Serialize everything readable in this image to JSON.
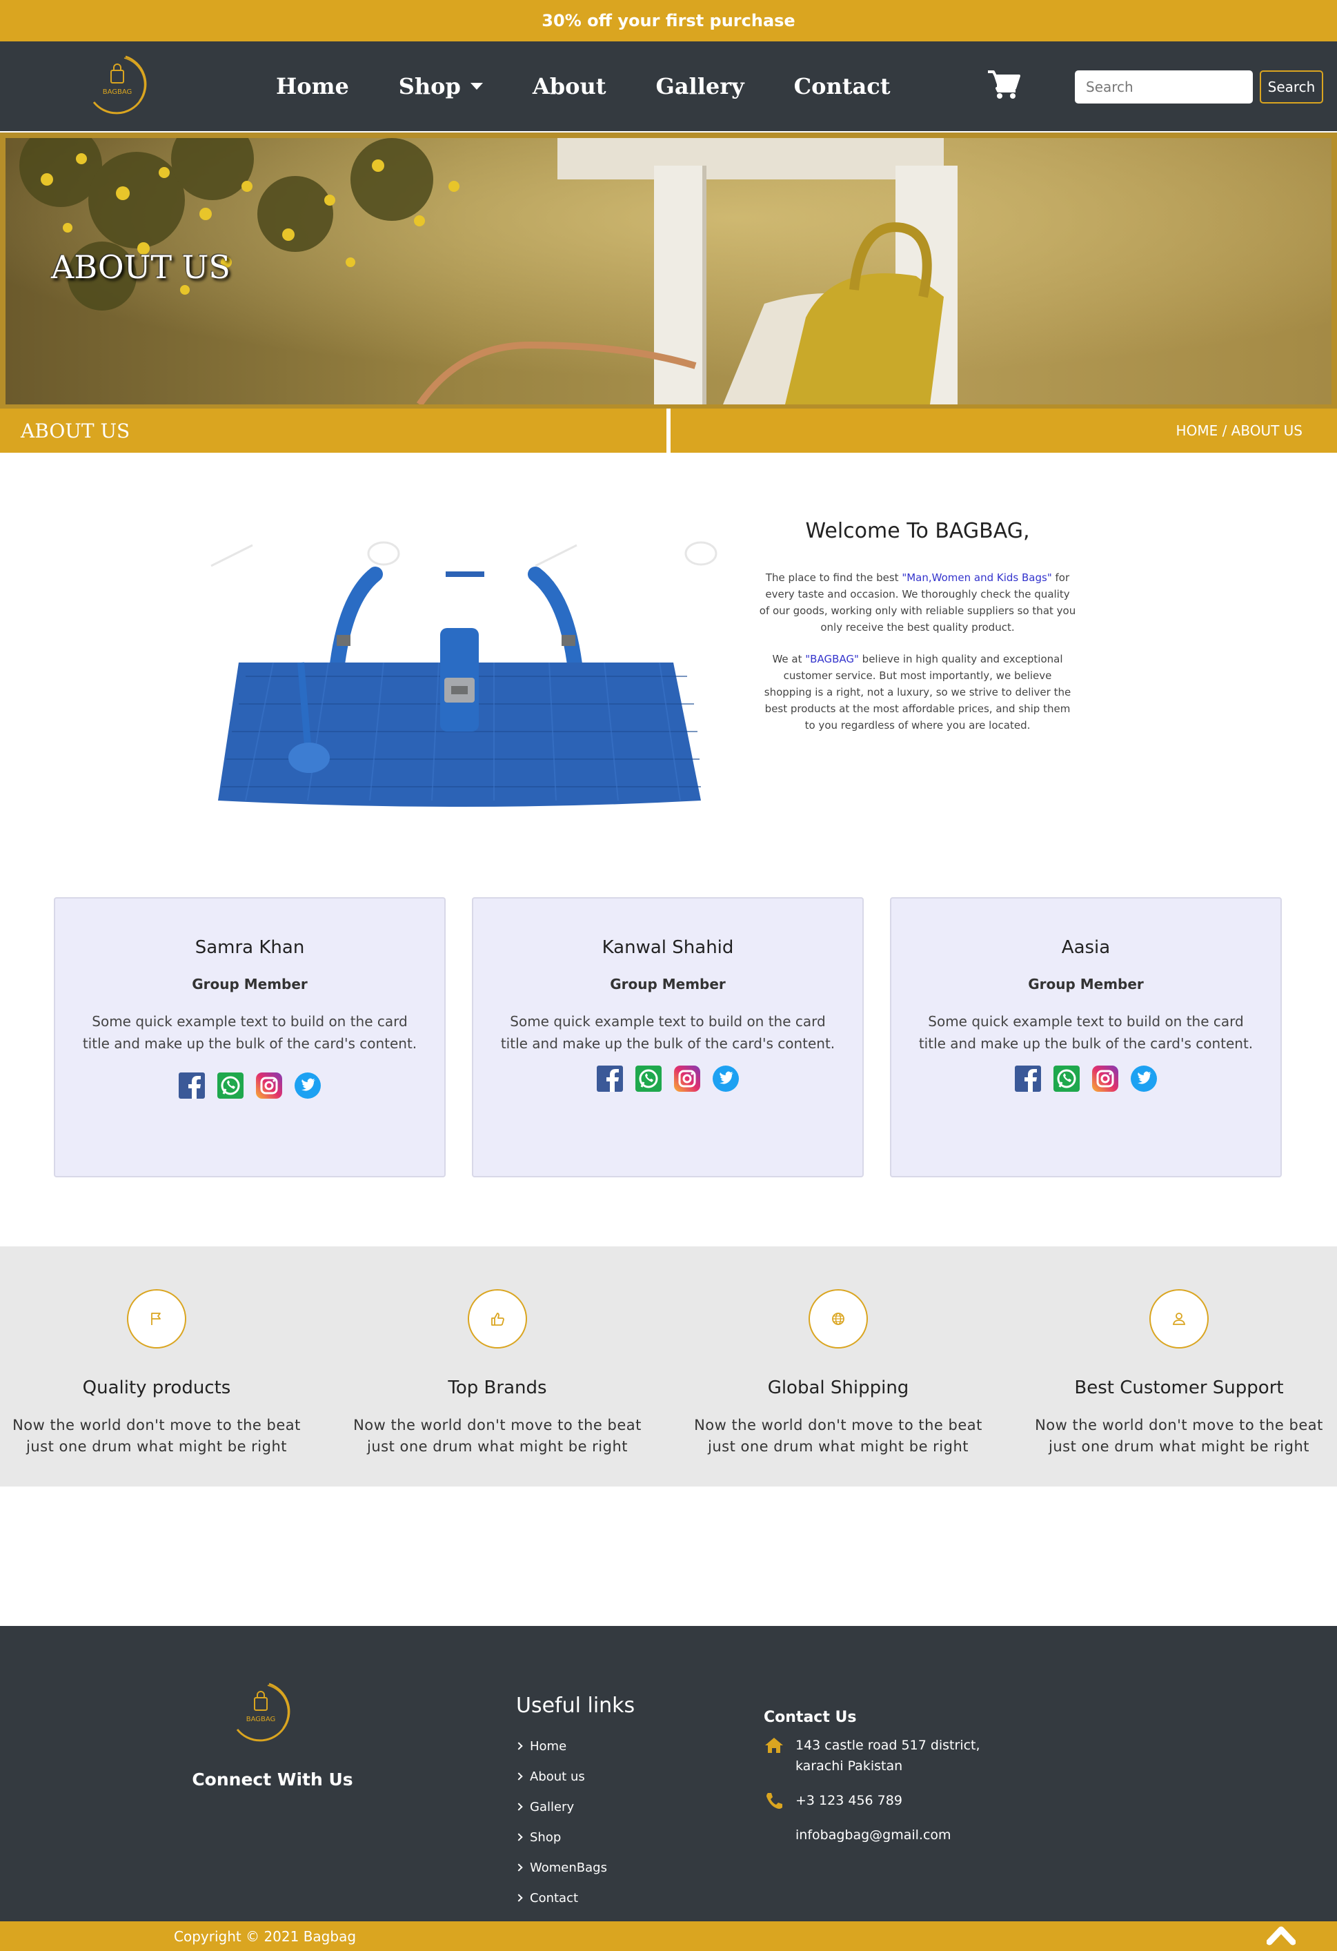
{
  "promo": {
    "text": "30% off your first purchase"
  },
  "brand": {
    "name": "BAGBAG",
    "accent": "#daa520",
    "dark": "#343a40"
  },
  "nav": {
    "items": [
      {
        "label": "Home"
      },
      {
        "label": "Shop",
        "dropdown": true
      },
      {
        "label": "About"
      },
      {
        "label": "Gallery"
      },
      {
        "label": "Contact"
      }
    ],
    "cart_icon": "shopping-cart-icon",
    "search": {
      "placeholder": "Search",
      "button_label": "Search"
    }
  },
  "hero": {
    "title": "ABOUT US"
  },
  "breadcrumb": {
    "title": "ABOUT US",
    "path": "HOME / ABOUT US"
  },
  "welcome": {
    "heading": "Welcome To BAGBAG,",
    "p1_before": "The place to find the best ",
    "p1_highlight": "\"Man,Women and Kids Bags\"",
    "p1_after": " for every taste and occasion. We thoroughly check the quality of our goods, working only with reliable suppliers so that you only receive the best quality product.",
    "p2_before": "We at ",
    "p2_highlight": "\"BAGBAG\"",
    "p2_after": " believe in high quality and exceptional customer service. But most importantly, we believe shopping is a right, not a luxury, so we strive to deliver the best products at the most affordable prices, and ship them to you regardless of where you are located."
  },
  "team": [
    {
      "name": "Samra Khan",
      "role": "Group Member",
      "text": "Some quick example text to build on the card title and make up the bulk of the card's content."
    },
    {
      "name": "Kanwal Shahid",
      "role": "Group Member",
      "text": "Some quick example text to build on the card title and make up the bulk of the card's content."
    },
    {
      "name": "Aasia",
      "role": "Group Member",
      "text": "Some quick example text to build on the card title and make up the bulk of the card's content."
    }
  ],
  "social_icons": [
    "facebook-icon",
    "whatsapp-icon",
    "instagram-icon",
    "twitter-icon"
  ],
  "features": [
    {
      "icon": "flag-icon",
      "title": "Quality products",
      "text": "Now the world don't move to the beat just one drum what might be right"
    },
    {
      "icon": "thumbs-up-icon",
      "title": "Top Brands",
      "text": "Now the world don't move to the beat just one drum what might be right"
    },
    {
      "icon": "globe-icon",
      "title": "Global Shipping",
      "text": "Now the world don't move to the beat just one drum what might be right"
    },
    {
      "icon": "user-icon",
      "title": "Best Customer Support",
      "text": "Now the world don't move to the beat just one drum what might be right"
    }
  ],
  "footer": {
    "connect": "Connect With Us",
    "useful_title": "Useful links",
    "links": [
      "Home",
      "About us",
      "Gallery",
      "Shop",
      "WomenBags",
      "Contact"
    ],
    "contact_title": "Contact Us",
    "address_line1": "143 castle road 517 district,",
    "address_line2": "karachi Pakistan",
    "phone": "+3 123 456 789",
    "email": "infobagbag@gmail.com",
    "copyright": "Copyright © 2021 Bagbag"
  }
}
